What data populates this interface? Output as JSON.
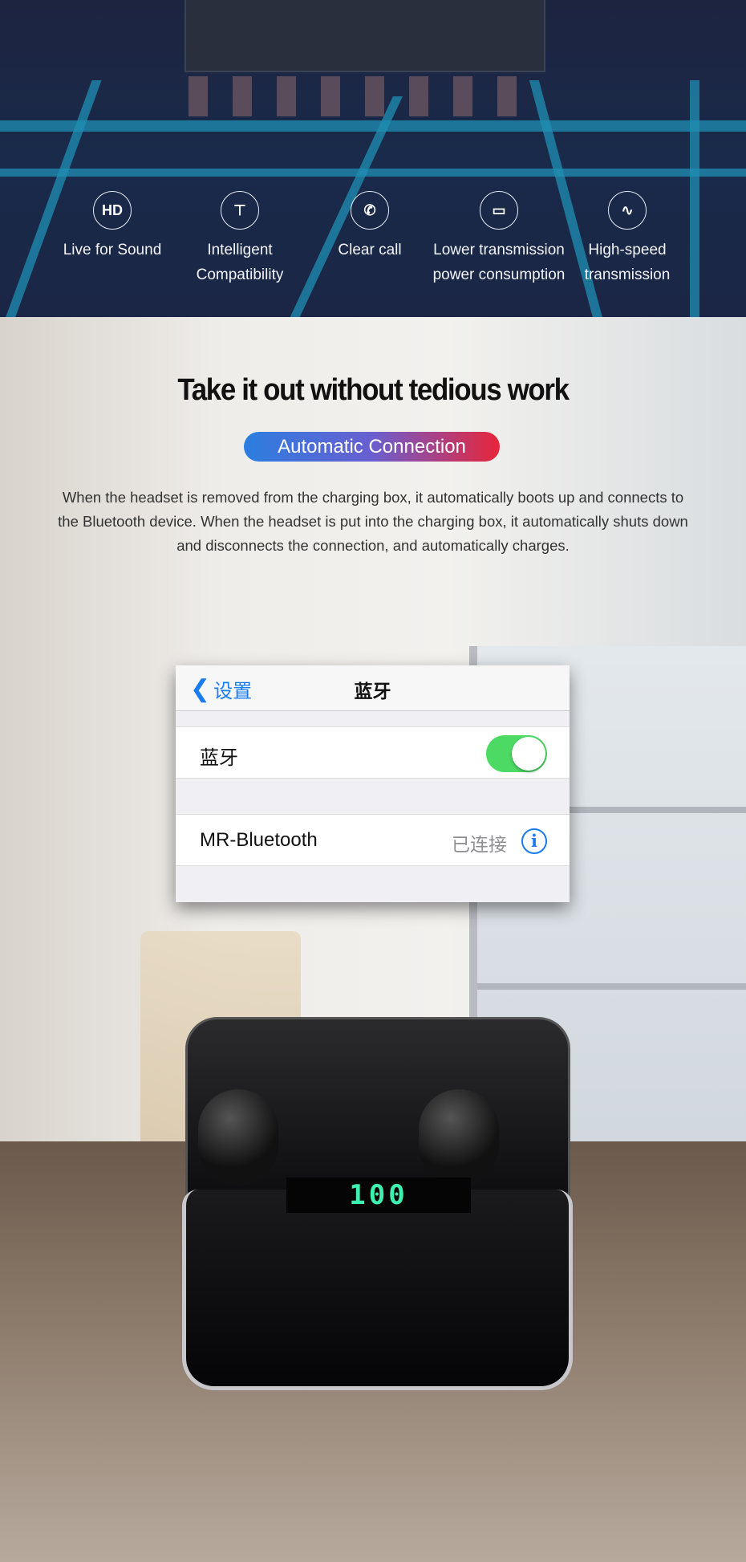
{
  "features": [
    {
      "icon": "hd-icon",
      "glyph": "HD",
      "label": "Live for Sound"
    },
    {
      "icon": "network-icon",
      "glyph": "⊤",
      "label": "Intelligent Compatibility"
    },
    {
      "icon": "phone-icon",
      "glyph": "✆",
      "label": "Clear call"
    },
    {
      "icon": "battery-icon",
      "glyph": "▭",
      "label": "Lower transmission power consumption"
    },
    {
      "icon": "pulse-icon",
      "glyph": "∿",
      "label": "High-speed transmission"
    }
  ],
  "heading": "Take it out without tedious work",
  "badge": "Automatic Connection",
  "description": "When the headset is removed from the charging box, it automatically boots up and connects to the Bluetooth device. When the headset is put into the charging box, it automatically shuts down and disconnects the connection, and automatically charges.",
  "settings": {
    "back_label": "设置",
    "title": "蓝牙",
    "bluetooth_label": "蓝牙",
    "bluetooth_on": true,
    "device_name": "MR-Bluetooth",
    "device_status": "已连接",
    "toggle_color": "#4cd964",
    "accent": "#1a7cf0"
  },
  "case_display": "100"
}
